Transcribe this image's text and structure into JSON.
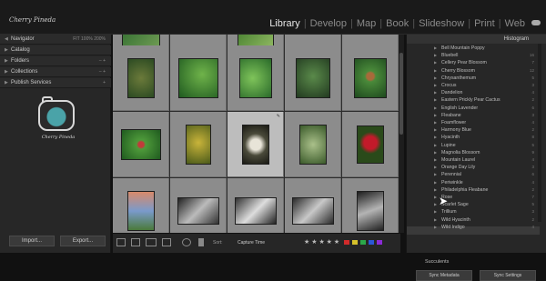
{
  "app": {
    "logo_text": "Cherry Pineda",
    "modules": [
      "Library",
      "Develop",
      "Map",
      "Book",
      "Slideshow",
      "Print",
      "Web"
    ],
    "active_module": "Library"
  },
  "left_panel": {
    "rows": [
      {
        "label": "Navigator",
        "right": "FIT   100%   200%"
      },
      {
        "label": "Catalog",
        "right": ""
      },
      {
        "label": "Folders",
        "right": "– +"
      },
      {
        "label": "Collections",
        "right": "– +"
      },
      {
        "label": "Publish Services",
        "right": "+"
      }
    ],
    "identity_name": "Cherry Pineda",
    "import_label": "Import...",
    "export_label": "Export..."
  },
  "grid": {
    "selected_index": 7
  },
  "toolbar": {
    "sort_label": "Sort:",
    "sort_value": "Capture Time",
    "stars": "★ ★ ★ ★ ★",
    "color_labels": [
      "#d12b2b",
      "#d6c12b",
      "#2ba84a",
      "#2b57d6",
      "#8b2bd6"
    ]
  },
  "right_panel": {
    "histogram_label": "Histogram",
    "keywords": [
      {
        "label": "Bell Mountain Poppy",
        "count": ""
      },
      {
        "label": "Bluebell",
        "count": "16"
      },
      {
        "label": "Cellery Pear Blossom",
        "count": "7"
      },
      {
        "label": "Cherry Blossom",
        "count": "12"
      },
      {
        "label": "Chrysanthemum",
        "count": "5"
      },
      {
        "label": "Crocus",
        "count": "3"
      },
      {
        "label": "Dandelion",
        "count": "4"
      },
      {
        "label": "Eastern Prickly Pear Cactus",
        "count": "2"
      },
      {
        "label": "English Lavender",
        "count": "6"
      },
      {
        "label": "Fleabane",
        "count": "3"
      },
      {
        "label": "Foamflower",
        "count": "4"
      },
      {
        "label": "Harmony Blue",
        "count": "2"
      },
      {
        "label": "Hyacinth",
        "count": "8"
      },
      {
        "label": "Lupine",
        "count": "5"
      },
      {
        "label": "Magnolia Blossom",
        "count": "9"
      },
      {
        "label": "Mountain Laurel",
        "count": "4"
      },
      {
        "label": "Orange Day Lily",
        "count": "3"
      },
      {
        "label": "Perennial",
        "count": "6"
      },
      {
        "label": "Periwinkle",
        "count": "4"
      },
      {
        "label": "Philadelphia Fleabane",
        "count": "2"
      },
      {
        "label": "Rose",
        "count": "7"
      },
      {
        "label": "Scarlet Sage",
        "count": "5"
      },
      {
        "label": "Trillium",
        "count": "3"
      },
      {
        "label": "Wild Hyacinth",
        "count": "2"
      },
      {
        "label": "Wild Indigo",
        "count": "4"
      }
    ],
    "successors": "Succulents",
    "sync_metadata_label": "Sync Metadata",
    "sync_settings_label": "Sync Settings"
  },
  "colors": {
    "active_module": "#e6e6e6",
    "panel_bg": "#272727",
    "cell_bg": "#8c8c8c",
    "selected_cell_bg": "#bdbdbd"
  }
}
